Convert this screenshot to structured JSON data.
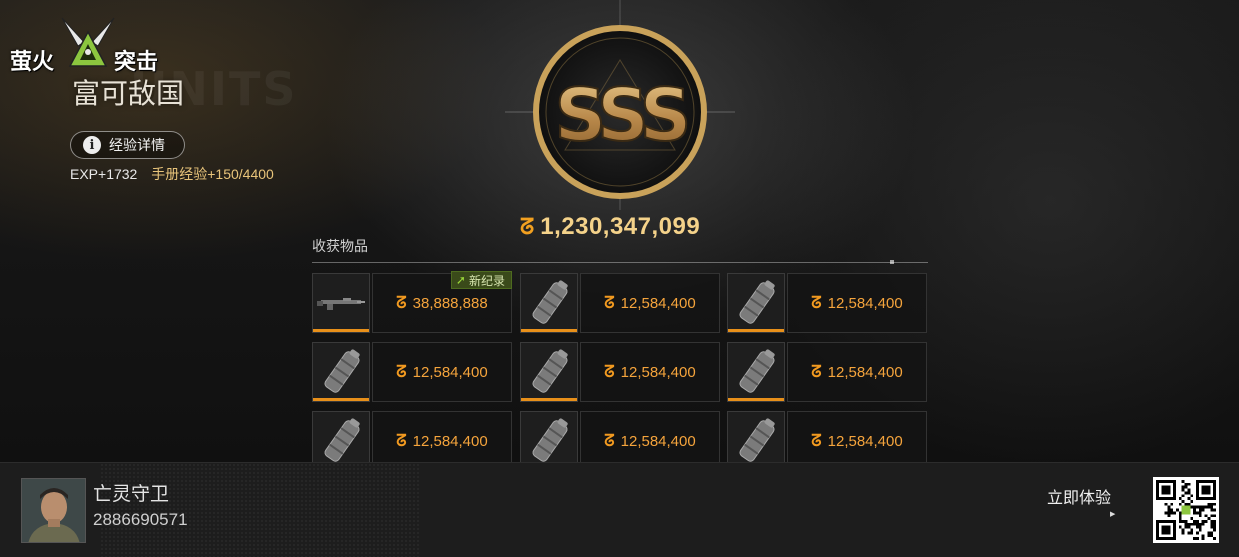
{
  "logo": {
    "left_text": "萤火",
    "right_text": "突击"
  },
  "page_title": "富可敌国",
  "experience": {
    "details_button": "经验详情",
    "exp_gain": "EXP+1732",
    "manual_exp": "手册经验+150/4400"
  },
  "rating": "SSS",
  "total_value": "1,230,347,099",
  "items_section": {
    "label": "收获物品",
    "record_badge": "新纪录",
    "items": [
      {
        "icon": "rifle-icon",
        "value": "38,888,888",
        "record": true
      },
      {
        "icon": "canister-icon",
        "value": "12,584,400",
        "record": false
      },
      {
        "icon": "canister-icon",
        "value": "12,584,400",
        "record": false
      },
      {
        "icon": "canister-icon",
        "value": "12,584,400",
        "record": false
      },
      {
        "icon": "canister-icon",
        "value": "12,584,400",
        "record": false
      },
      {
        "icon": "canister-icon",
        "value": "12,584,400",
        "record": false
      },
      {
        "icon": "canister-icon",
        "value": "12,584,400",
        "record": false
      },
      {
        "icon": "canister-icon",
        "value": "12,584,400",
        "record": false
      },
      {
        "icon": "canister-icon",
        "value": "12,584,400",
        "record": false
      }
    ]
  },
  "player": {
    "name": "亡灵守卫",
    "id": "2886690571"
  },
  "cta": {
    "label": "立即体验"
  },
  "colors": {
    "accent": "#e8901a",
    "gold": "#c9a25a",
    "record_green": "#4e6b1f"
  }
}
